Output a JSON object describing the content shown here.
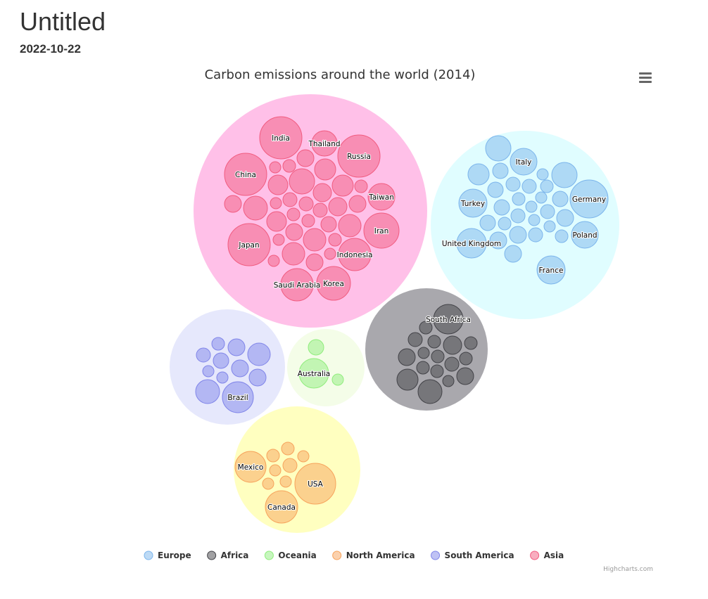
{
  "page": {
    "title": "Untitled",
    "date": "2022-10-22"
  },
  "chart_data": {
    "type": "packedbubble",
    "title": "Carbon emissions around the world (2014)",
    "credits": "Highcharts.com",
    "legend_placement": "bottom",
    "series": [
      {
        "name": "Europe",
        "color": "#7cb5ec",
        "parent_color": "#e0fdff",
        "points": [
          "Italy",
          "Turkey",
          "Germany",
          "Poland",
          "United Kingdom",
          "France",
          "",
          "",
          "",
          "",
          "",
          "",
          "",
          "",
          "",
          "",
          "",
          "",
          "",
          "",
          "",
          "",
          "",
          "",
          "",
          "",
          "",
          "",
          "",
          "",
          "",
          ""
        ]
      },
      {
        "name": "Africa",
        "color": "#434348",
        "parent_color": "#a9a8ad",
        "points": [
          "South Africa",
          "",
          "",
          "",
          "",
          "",
          "",
          "",
          "",
          "",
          "",
          "",
          "",
          "",
          "",
          "",
          ""
        ]
      },
      {
        "name": "Oceania",
        "color": "#90ed7d",
        "parent_color": "#f4fde8",
        "points": [
          "Australia",
          "",
          ""
        ]
      },
      {
        "name": "North America",
        "color": "#f7a35c",
        "parent_color": "#ffffc0",
        "points": [
          "USA",
          "Canada",
          "Mexico",
          "",
          "",
          "",
          "",
          "",
          "",
          ""
        ]
      },
      {
        "name": "South America",
        "color": "#8085e9",
        "parent_color": "#e6e8fc",
        "points": [
          "Brazil",
          "",
          "",
          "",
          "",
          "",
          "",
          "",
          "",
          "",
          ""
        ]
      },
      {
        "name": "Asia",
        "color": "#f15c80",
        "parent_color": "#ffc0e8",
        "points": [
          "India",
          "Thailand",
          "Russia",
          "China",
          "Taiwan",
          "Iran",
          "Japan",
          "Indonesia",
          "Korea",
          "Saudi Arabia",
          "",
          "",
          "",
          "",
          "",
          "",
          "",
          "",
          "",
          "",
          "",
          "",
          "",
          "",
          "",
          "",
          "",
          "",
          "",
          "",
          "",
          "",
          "",
          "",
          "",
          "",
          "",
          "",
          "",
          "",
          ""
        ]
      }
    ]
  }
}
